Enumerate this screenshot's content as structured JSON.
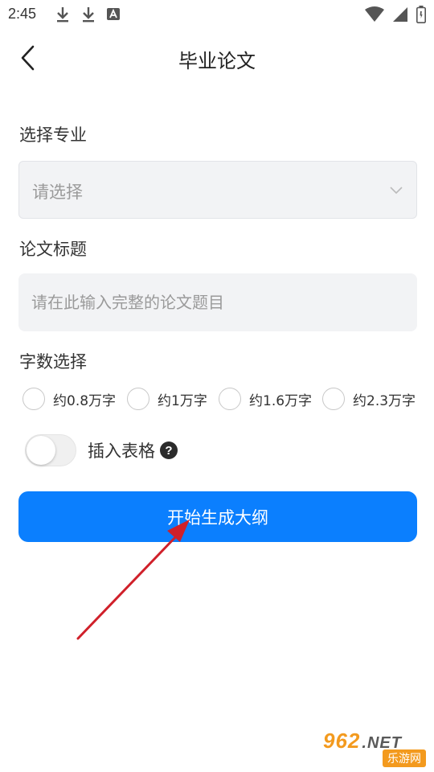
{
  "status_bar": {
    "time": "2:45",
    "icons": [
      "download-icon",
      "download-icon",
      "a-icon",
      "wifi-icon",
      "signal-icon",
      "battery-icon"
    ]
  },
  "header": {
    "title": "毕业论文",
    "back_icon": "chevron-left-icon"
  },
  "form": {
    "major": {
      "label": "选择专业",
      "value": "请选择"
    },
    "title_field": {
      "label": "论文标题",
      "placeholder": "请在此输入完整的论文题目",
      "value": ""
    },
    "word_count": {
      "label": "字数选择",
      "options": [
        "约0.8万字",
        "约1万字",
        "约1.6万字",
        "约2.3万字"
      ]
    },
    "insert_table": {
      "label": "插入表格",
      "enabled": false,
      "help_glyph": "?"
    },
    "submit_label": "开始生成大纲"
  },
  "colors": {
    "primary": "#0b7ffe",
    "field_bg": "#f2f3f5",
    "annotation_arrow": "#d0202a"
  },
  "watermark": {
    "brand": "962",
    "suffix": ".NET",
    "caption": "乐游网"
  }
}
